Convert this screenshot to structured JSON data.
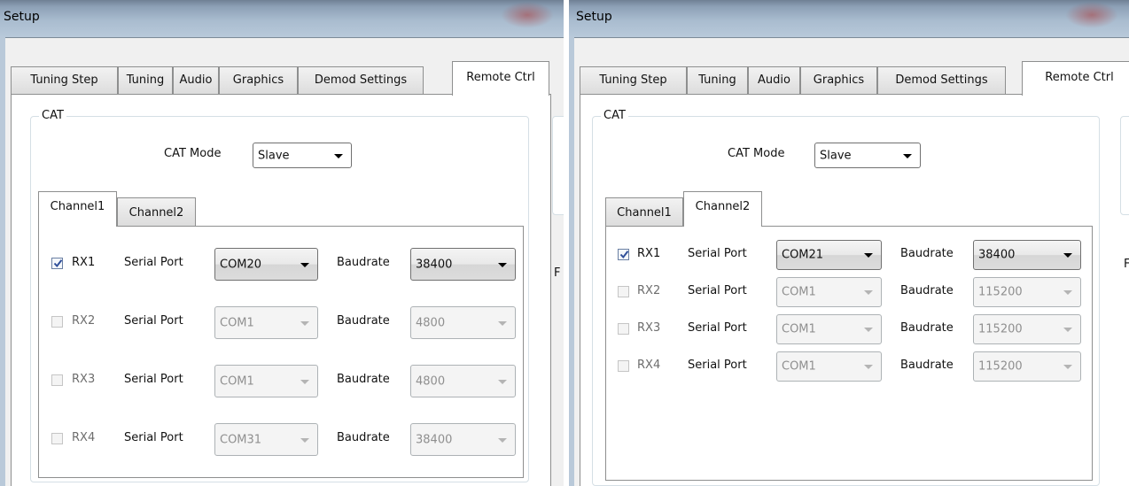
{
  "colors": {
    "accent": "#7d99c5",
    "checkmark": "#2f4f9a",
    "title_glow": "#aa3c3c"
  },
  "left": {
    "window_title": "Setup",
    "tabs": [
      "Tuning Step",
      "Tuning",
      "Audio",
      "Graphics",
      "Demod Settings",
      "Remote Ctrl"
    ],
    "active_tab": "Remote Ctrl",
    "cat_group_label": "CAT",
    "cat_mode_label": "CAT Mode",
    "cat_mode_value": "Slave",
    "subtabs": [
      "Channel1",
      "Channel2"
    ],
    "active_subtab": "Channel1",
    "serial_port_label": "Serial Port",
    "baudrate_label": "Baudrate",
    "side_letter": "F",
    "rows": [
      {
        "name": "RX1",
        "checked": true,
        "port": "COM20",
        "baud": "38400",
        "enabled": true
      },
      {
        "name": "RX2",
        "checked": false,
        "port": "COM1",
        "baud": "4800",
        "enabled": false
      },
      {
        "name": "RX3",
        "checked": false,
        "port": "COM1",
        "baud": "4800",
        "enabled": false
      },
      {
        "name": "RX4",
        "checked": false,
        "port": "COM31",
        "baud": "38400",
        "enabled": false
      }
    ]
  },
  "right": {
    "window_title": "Setup",
    "tabs": [
      "Tuning Step",
      "Tuning",
      "Audio",
      "Graphics",
      "Demod Settings",
      "Remote Ctrl"
    ],
    "active_tab": "Remote Ctrl",
    "cat_group_label": "CAT",
    "cat_mode_label": "CAT Mode",
    "cat_mode_value": "Slave",
    "subtabs": [
      "Channel1",
      "Channel2"
    ],
    "active_subtab": "Channel2",
    "serial_port_label": "Serial Port",
    "baudrate_label": "Baudrate",
    "side_letter": "F",
    "rows": [
      {
        "name": "RX1",
        "checked": true,
        "port": "COM21",
        "baud": "38400",
        "enabled": true
      },
      {
        "name": "RX2",
        "checked": false,
        "port": "COM1",
        "baud": "115200",
        "enabled": false
      },
      {
        "name": "RX3",
        "checked": false,
        "port": "COM1",
        "baud": "115200",
        "enabled": false
      },
      {
        "name": "RX4",
        "checked": false,
        "port": "COM1",
        "baud": "115200",
        "enabled": false
      }
    ]
  }
}
